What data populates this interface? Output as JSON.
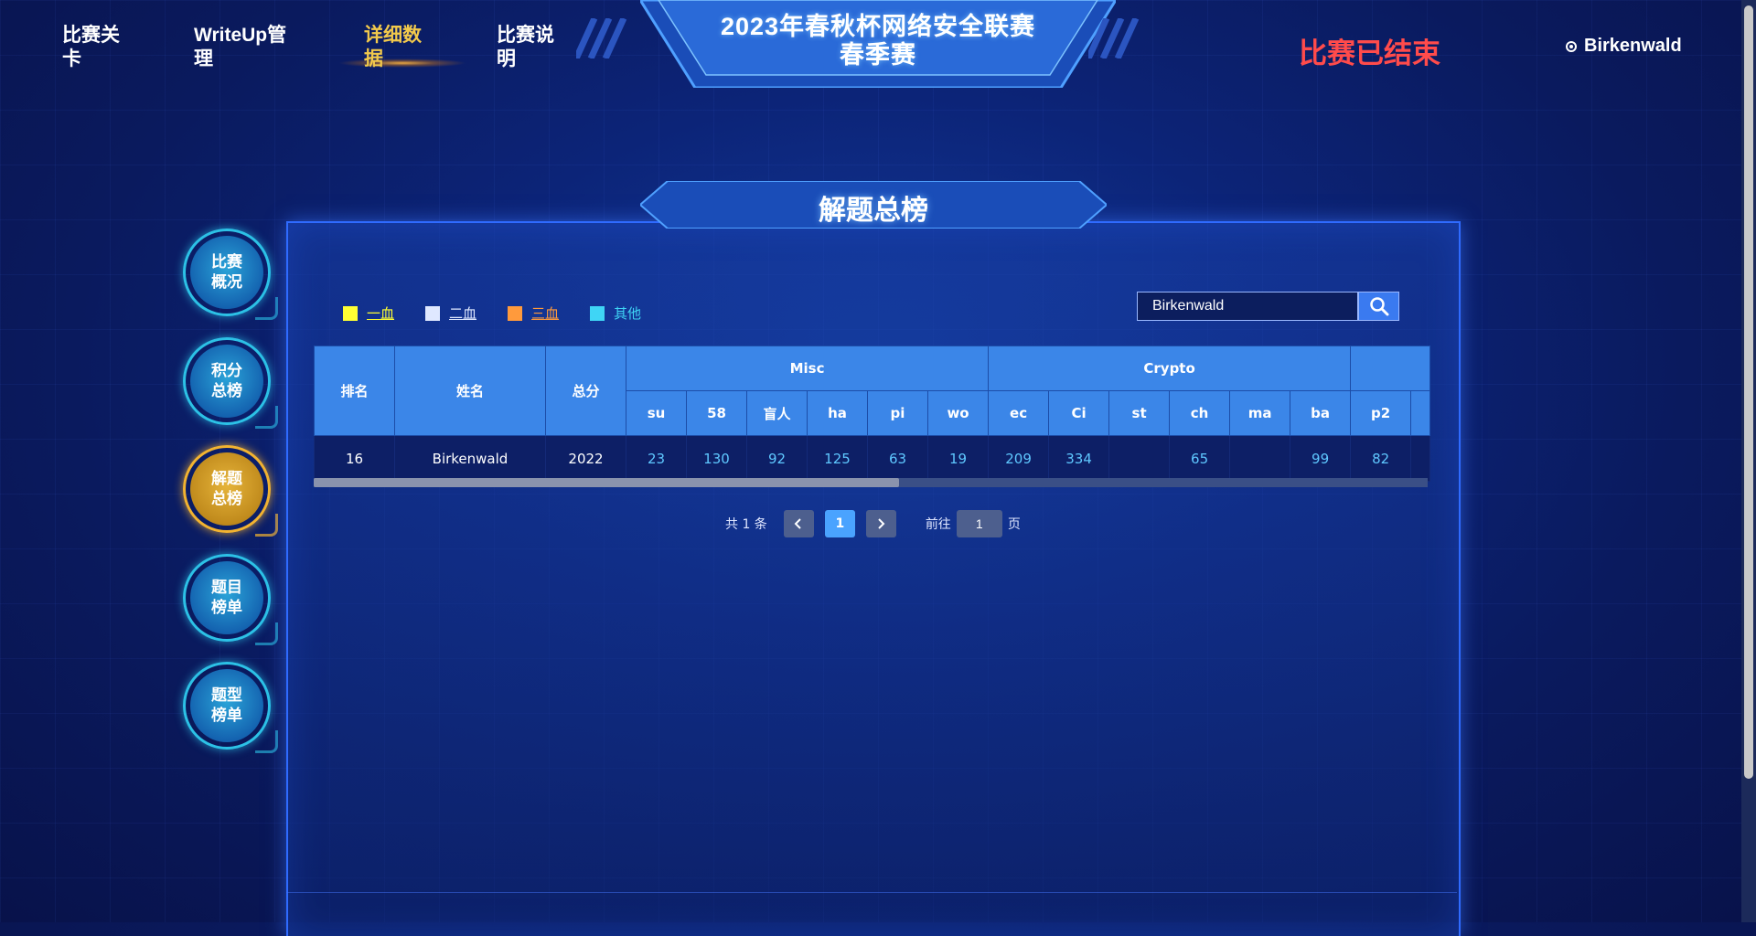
{
  "nav": {
    "items": [
      {
        "label_line1": "比赛关",
        "label_line2": "卡"
      },
      {
        "label_line1": "WriteUp管",
        "label_line2": "理"
      },
      {
        "label_line1": "详细数",
        "label_line2": "据"
      },
      {
        "label_line1": "比赛说",
        "label_line2": "明"
      }
    ],
    "active_index": 2
  },
  "header": {
    "title_line1": "2023年春秋杯网络安全联赛",
    "title_line2": "春季赛",
    "status": "比赛已结束",
    "username": "Birkenwald"
  },
  "side_nav": [
    {
      "line1": "比赛",
      "line2": "概况"
    },
    {
      "line1": "积分",
      "line2": "总榜"
    },
    {
      "line1": "解题",
      "line2": "总榜"
    },
    {
      "line1": "题目",
      "line2": "榜单"
    },
    {
      "line1": "题型",
      "line2": "榜单"
    }
  ],
  "panel": {
    "title": "解题总榜"
  },
  "legend": [
    {
      "label": "一血",
      "color": "#ffff33"
    },
    {
      "label": "二血",
      "color": "#dfe8ff"
    },
    {
      "label": "三血",
      "color": "#ff9a3c"
    },
    {
      "label": "其他",
      "color": "#3fd5f5"
    }
  ],
  "search": {
    "value": "Birkenwald"
  },
  "table": {
    "fixed_headers": [
      "排名",
      "姓名",
      "总分"
    ],
    "groups": [
      {
        "name": "Misc",
        "columns": [
          "su",
          "58",
          "盲人",
          "ha",
          "pi",
          "wo"
        ]
      },
      {
        "name": "Crypto",
        "columns": [
          "ec",
          "Ci",
          "st",
          "ch",
          "ma",
          "ba"
        ]
      },
      {
        "name": "",
        "columns": [
          "p2"
        ]
      }
    ],
    "rows": [
      {
        "rank": "16",
        "name": "Birkenwald",
        "total": "2022",
        "scores": [
          "23",
          "130",
          "92",
          "125",
          "63",
          "19",
          "209",
          "334",
          "",
          "65",
          "",
          "99",
          "82"
        ]
      }
    ]
  },
  "pagination": {
    "total_text": "共 1 条",
    "current_page": "1",
    "goto_label": "前往",
    "goto_value": "1",
    "page_suffix": "页"
  },
  "colors": {
    "accent": "#3b86e8",
    "status": "#ff4b4b",
    "active": "#f2c94c"
  }
}
